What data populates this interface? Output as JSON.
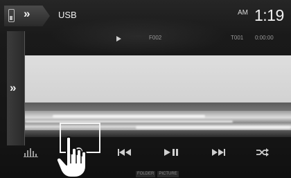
{
  "top_bar": {
    "source": "USB",
    "ampm": "AM",
    "clock": "1:19"
  },
  "info_bar": {
    "folder": "F002",
    "track": "T001",
    "play_time": "0:00:00"
  },
  "mode_labels": [
    "FOLDER",
    "PICTURE"
  ],
  "icons": {
    "usb": "usb-icon",
    "source_chevron": "double-chevron-right-icon",
    "side_panel": "double-chevron-right-icon",
    "play_state": "play-icon",
    "equalizer": "equalizer-icon",
    "search": "search-icon",
    "previous": "skip-previous-icon",
    "play_pause": "play-pause-icon",
    "next": "skip-next-icon",
    "shuffle": "shuffle-icon",
    "pointer": "hand-pointer-icon"
  },
  "colors": {
    "background": "#141414",
    "text": "#f0f0f0",
    "dim_text": "#9a9a9a",
    "highlight_border": "#f5f5f5"
  }
}
